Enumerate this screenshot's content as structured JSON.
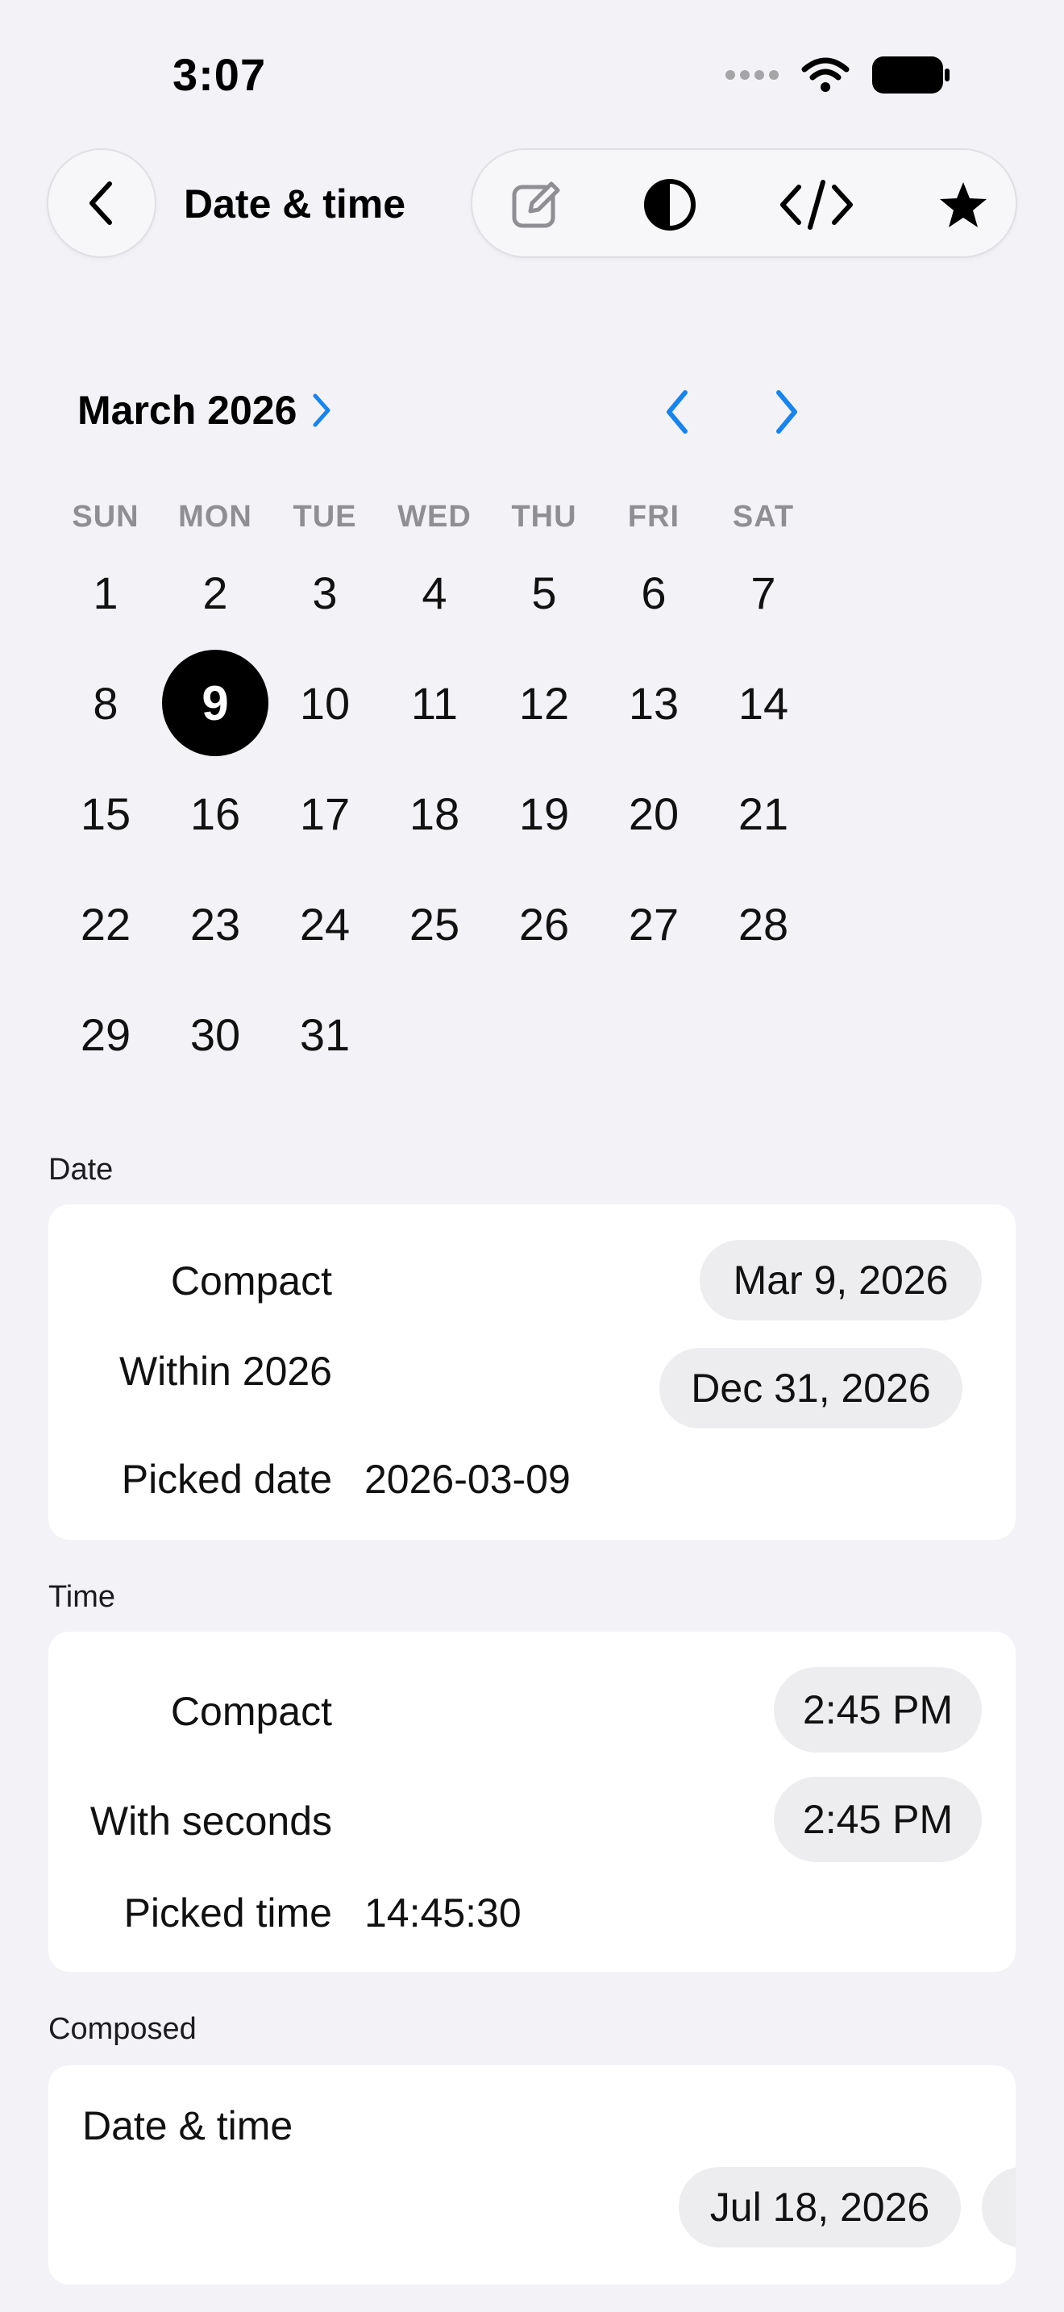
{
  "status": {
    "time": "3:07"
  },
  "nav": {
    "title": "Date & time"
  },
  "toolbar": {
    "icons": [
      "edit-icon",
      "contrast-icon",
      "code-icon",
      "star-icon"
    ]
  },
  "calendar": {
    "month_label": "March 2026",
    "weekdays": [
      "SUN",
      "MON",
      "TUE",
      "WED",
      "THU",
      "FRI",
      "SAT"
    ],
    "weeks": [
      [
        "1",
        "2",
        "3",
        "4",
        "5",
        "6",
        "7"
      ],
      [
        "8",
        "9",
        "10",
        "11",
        "12",
        "13",
        "14"
      ],
      [
        "15",
        "16",
        "17",
        "18",
        "19",
        "20",
        "21"
      ],
      [
        "22",
        "23",
        "24",
        "25",
        "26",
        "27",
        "28"
      ],
      [
        "29",
        "30",
        "31"
      ]
    ],
    "selected_day": "9",
    "accent": "#1a84e8"
  },
  "date_section": {
    "label": "Date",
    "compact_label": "Compact",
    "compact_value": "Mar 9, 2026",
    "within_label": "Within 2026",
    "within_value": "Dec 31, 2026",
    "picked_label": "Picked date",
    "picked_value": "2026-03-09"
  },
  "time_section": {
    "label": "Time",
    "compact_label": "Compact",
    "compact_value": "2:45 PM",
    "seconds_label": "With seconds",
    "seconds_value": "2:45 PM",
    "picked_label": "Picked time",
    "picked_value": "14:45:30"
  },
  "composed_section": {
    "label": "Composed",
    "row_label": "Date & time",
    "date_value": "Jul 18, 2026"
  }
}
